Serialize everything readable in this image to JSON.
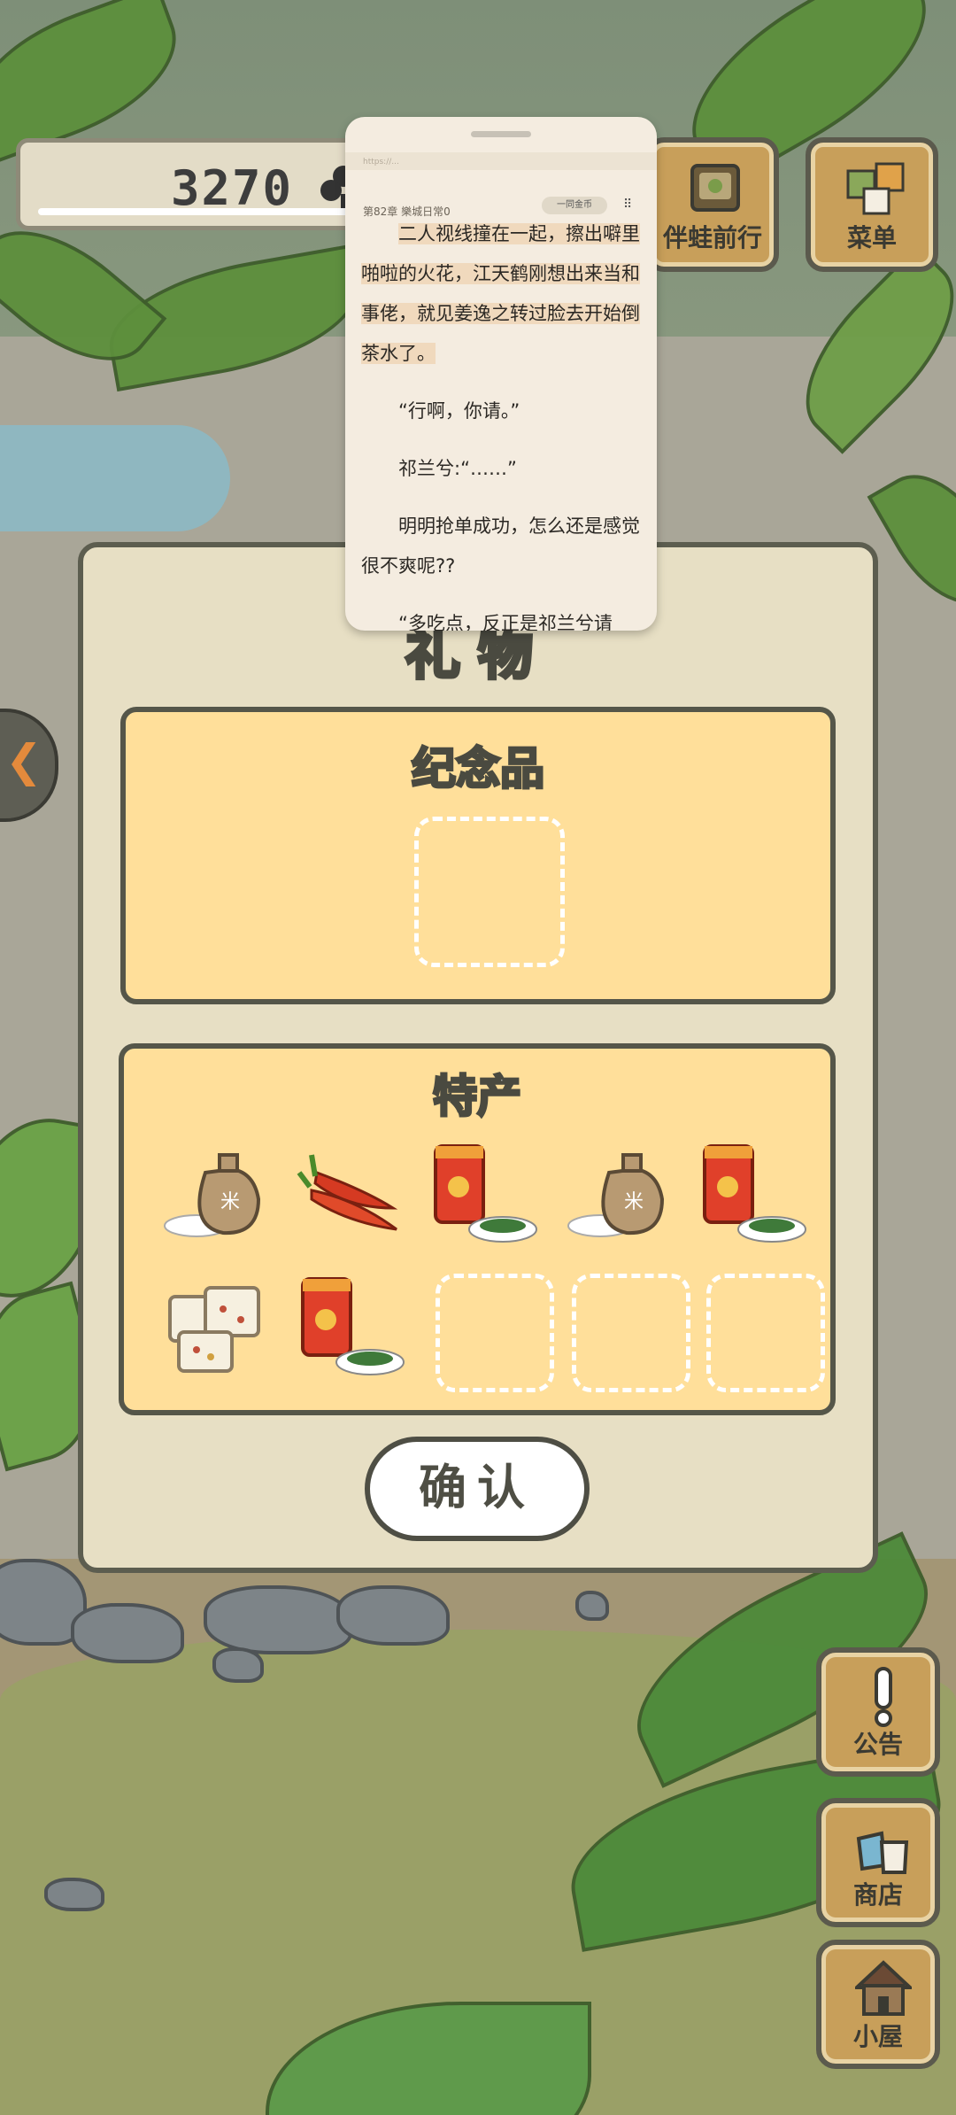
{
  "hud": {
    "clover_count": "3270",
    "travel_label": "伴蛙前行",
    "menu_label": "菜单"
  },
  "reader": {
    "url": "https://...",
    "chapter": "第82章 樂城日常0",
    "coin_pill": "一同金币",
    "paragraphs": [
      "二人视线撞在一起，擦出噼里啪啦的火花，江天鹤刚想出来当和事佬，就见姜逸之转过脸去开始倒茶水了。",
      "“行啊，你请。”",
      "祁兰兮:“……”",
      "明明抢单成功，怎么还是感觉很不爽呢??",
      "“多吃点，反正是祁兰兮请"
    ]
  },
  "panel": {
    "title": "礼物",
    "souvenir_title": "纪念品",
    "specialty_title": "特产",
    "specialty_items": [
      {
        "name": "rice-sack-icon"
      },
      {
        "name": "chili-peppers-icon"
      },
      {
        "name": "tea-can-icon"
      },
      {
        "name": "rice-sack-icon"
      },
      {
        "name": "tea-can-icon"
      },
      {
        "name": "nougat-candy-icon"
      },
      {
        "name": "tea-can-icon"
      }
    ],
    "confirm_label": "确认"
  },
  "side": {
    "notice_label": "公告",
    "shop_label": "商店",
    "house_label": "小屋"
  },
  "colors": {
    "panel_bg": "#e7dfc4",
    "section_bg": "#ffdf9a",
    "wood": "#c89f5a",
    "outline": "#555649"
  }
}
